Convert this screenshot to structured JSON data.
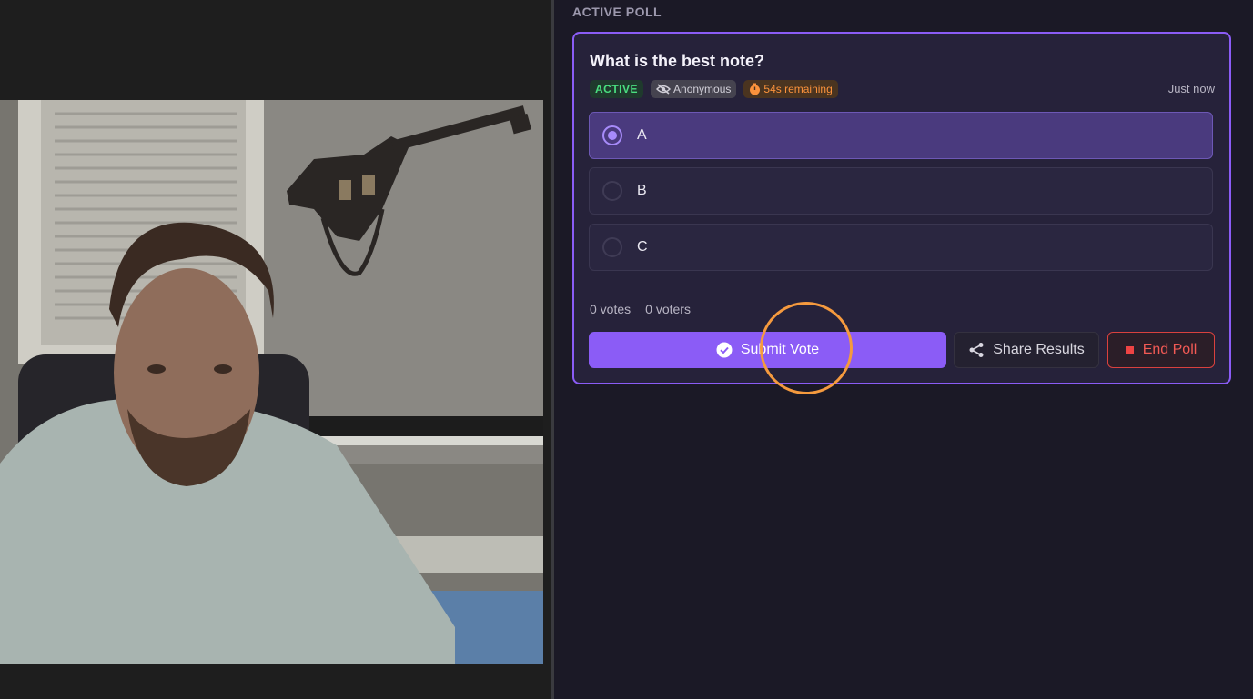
{
  "poll": {
    "section_title": "ACTIVE POLL",
    "question": "What is the best note?",
    "badges": {
      "status": "ACTIVE",
      "anonymous": "Anonymous",
      "timer": "54s remaining"
    },
    "timestamp": "Just now",
    "options": [
      {
        "label": "A",
        "selected": true
      },
      {
        "label": "B",
        "selected": false
      },
      {
        "label": "C",
        "selected": false
      }
    ],
    "stats": {
      "votes": "0 votes",
      "voters": "0 voters"
    },
    "actions": {
      "submit": "Submit Vote",
      "share": "Share Results",
      "end": "End Poll"
    }
  },
  "colors": {
    "accent": "#8b5cf6",
    "active_badge": "#4ade80",
    "timer_badge": "#fb923c",
    "danger": "#ef4444",
    "click_indicator": "#f59a3e"
  }
}
